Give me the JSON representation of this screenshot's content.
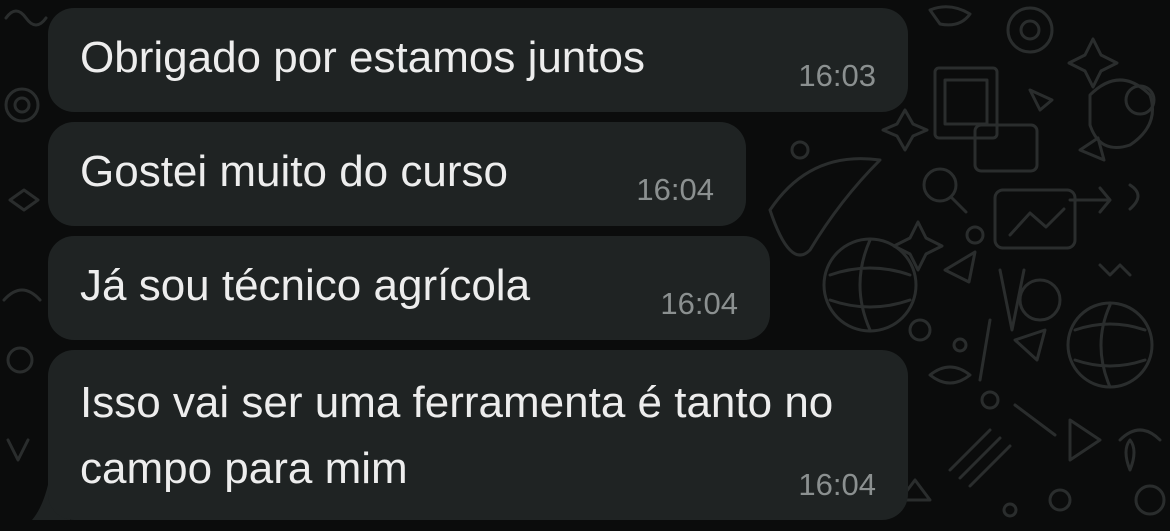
{
  "chat": {
    "messages": [
      {
        "text": "Obrigado por estamos juntos",
        "time": "16:03"
      },
      {
        "text": "Gostei muito do curso",
        "time": "16:04"
      },
      {
        "text": "Já sou técnico agrícola",
        "time": "16:04"
      },
      {
        "text": "Isso vai ser uma ferramenta é tanto no campo para mim",
        "time": "16:04"
      }
    ]
  },
  "colors": {
    "background": "#0b0c0c",
    "bubble": "#1f2323",
    "text": "#ededed",
    "timestamp": "#8b9090",
    "doodle": "#2a2d2d"
  }
}
